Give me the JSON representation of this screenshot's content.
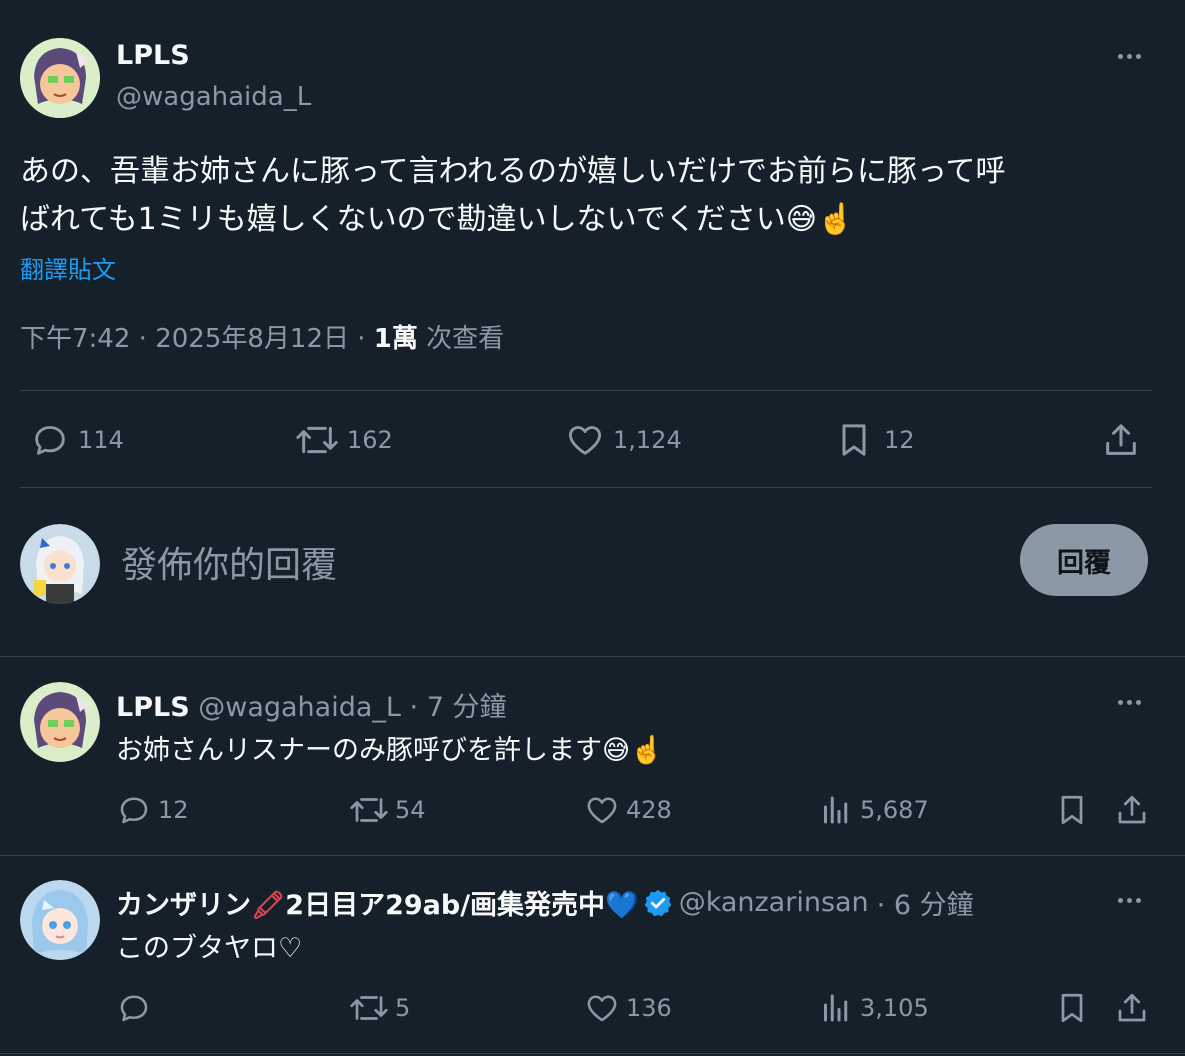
{
  "main_post": {
    "display_name": "LPLS",
    "handle": "@wagahaida_L",
    "text_line1": "あの、吾輩お姉さんに豚って言われるのが嬉しいだけでお前らに豚って呼",
    "text_line2": "ばれても1ミリも嬉しくないので勘違いしないでください",
    "emoji": "😅☝️",
    "translate_label": "翻譯貼文",
    "time": "下午7:42",
    "date": "2025年8月12日",
    "views_count": "1萬",
    "views_label": "次查看",
    "separator": "·",
    "stats": {
      "replies": "114",
      "reposts": "162",
      "likes": "1,124",
      "bookmarks": "12"
    }
  },
  "composer": {
    "placeholder": "發佈你的回覆",
    "reply_button": "回覆"
  },
  "replies": [
    {
      "display_name": "LPLS",
      "handle": "@wagahaida_L",
      "time": "· 7 分鐘",
      "text": "お姉さんリスナーのみ豚呼びを許します",
      "emoji": "😅☝️",
      "stats": {
        "replies": "12",
        "reposts": "54",
        "likes": "428",
        "views": "5,687"
      }
    },
    {
      "display_name": "カンザリン",
      "name_emoji1": "🖍",
      "display_name_rest": "2日目ア29ab/画集発売中",
      "name_emoji2": "💙",
      "handle": "@kanzarinsan",
      "time": "· 6 分鐘",
      "text": "このブタヤロ♡",
      "stats": {
        "replies": "",
        "reposts": "5",
        "likes": "136",
        "views": "3,105"
      }
    }
  ],
  "colors": {
    "background": "#15202b",
    "text": "#f7f9f9",
    "muted": "#8b98a5",
    "link": "#1d9bf0",
    "verified": "#1d9bf0",
    "divider": "#38444d",
    "reply_button_bg": "#8b98a5"
  },
  "icons": [
    "reply-icon",
    "repost-icon",
    "like-icon",
    "bookmark-icon",
    "share-icon",
    "views-icon",
    "more-icon",
    "verified-icon"
  ]
}
